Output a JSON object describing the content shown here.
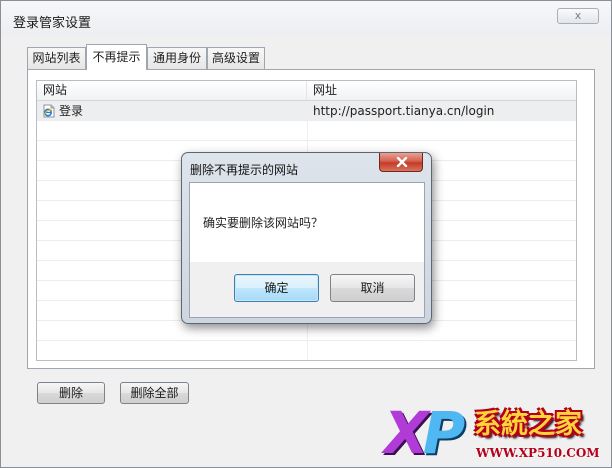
{
  "window": {
    "title": "登录管家设置",
    "close_glyph": "x"
  },
  "tabs": [
    {
      "label": "网站列表",
      "active": false
    },
    {
      "label": "不再提示",
      "active": true
    },
    {
      "label": "通用身份",
      "active": false
    },
    {
      "label": "高级设置",
      "active": false
    }
  ],
  "list": {
    "columns": [
      "网站",
      "网址"
    ],
    "rows": [
      {
        "site": "登录",
        "url": "http://passport.tianya.cn/login",
        "icon": "ie-page-icon"
      }
    ]
  },
  "buttons": {
    "delete": "删除",
    "delete_all": "删除全部"
  },
  "dialog": {
    "title": "删除不再提示的网站",
    "message": "确实要删除该网站吗？",
    "ok": "确定",
    "cancel": "取消"
  },
  "watermark": {
    "xp_x": "X",
    "xp_p": "P",
    "brand": "系統之家",
    "url": "WWW.XP510.COM"
  },
  "colors": {
    "close_red": "#c43b27",
    "default_button_border": "#3c7fb1",
    "logo_purple": "#b03bd6",
    "logo_blue": "#4fb8f2",
    "logo_yellow": "#ffd43a"
  }
}
